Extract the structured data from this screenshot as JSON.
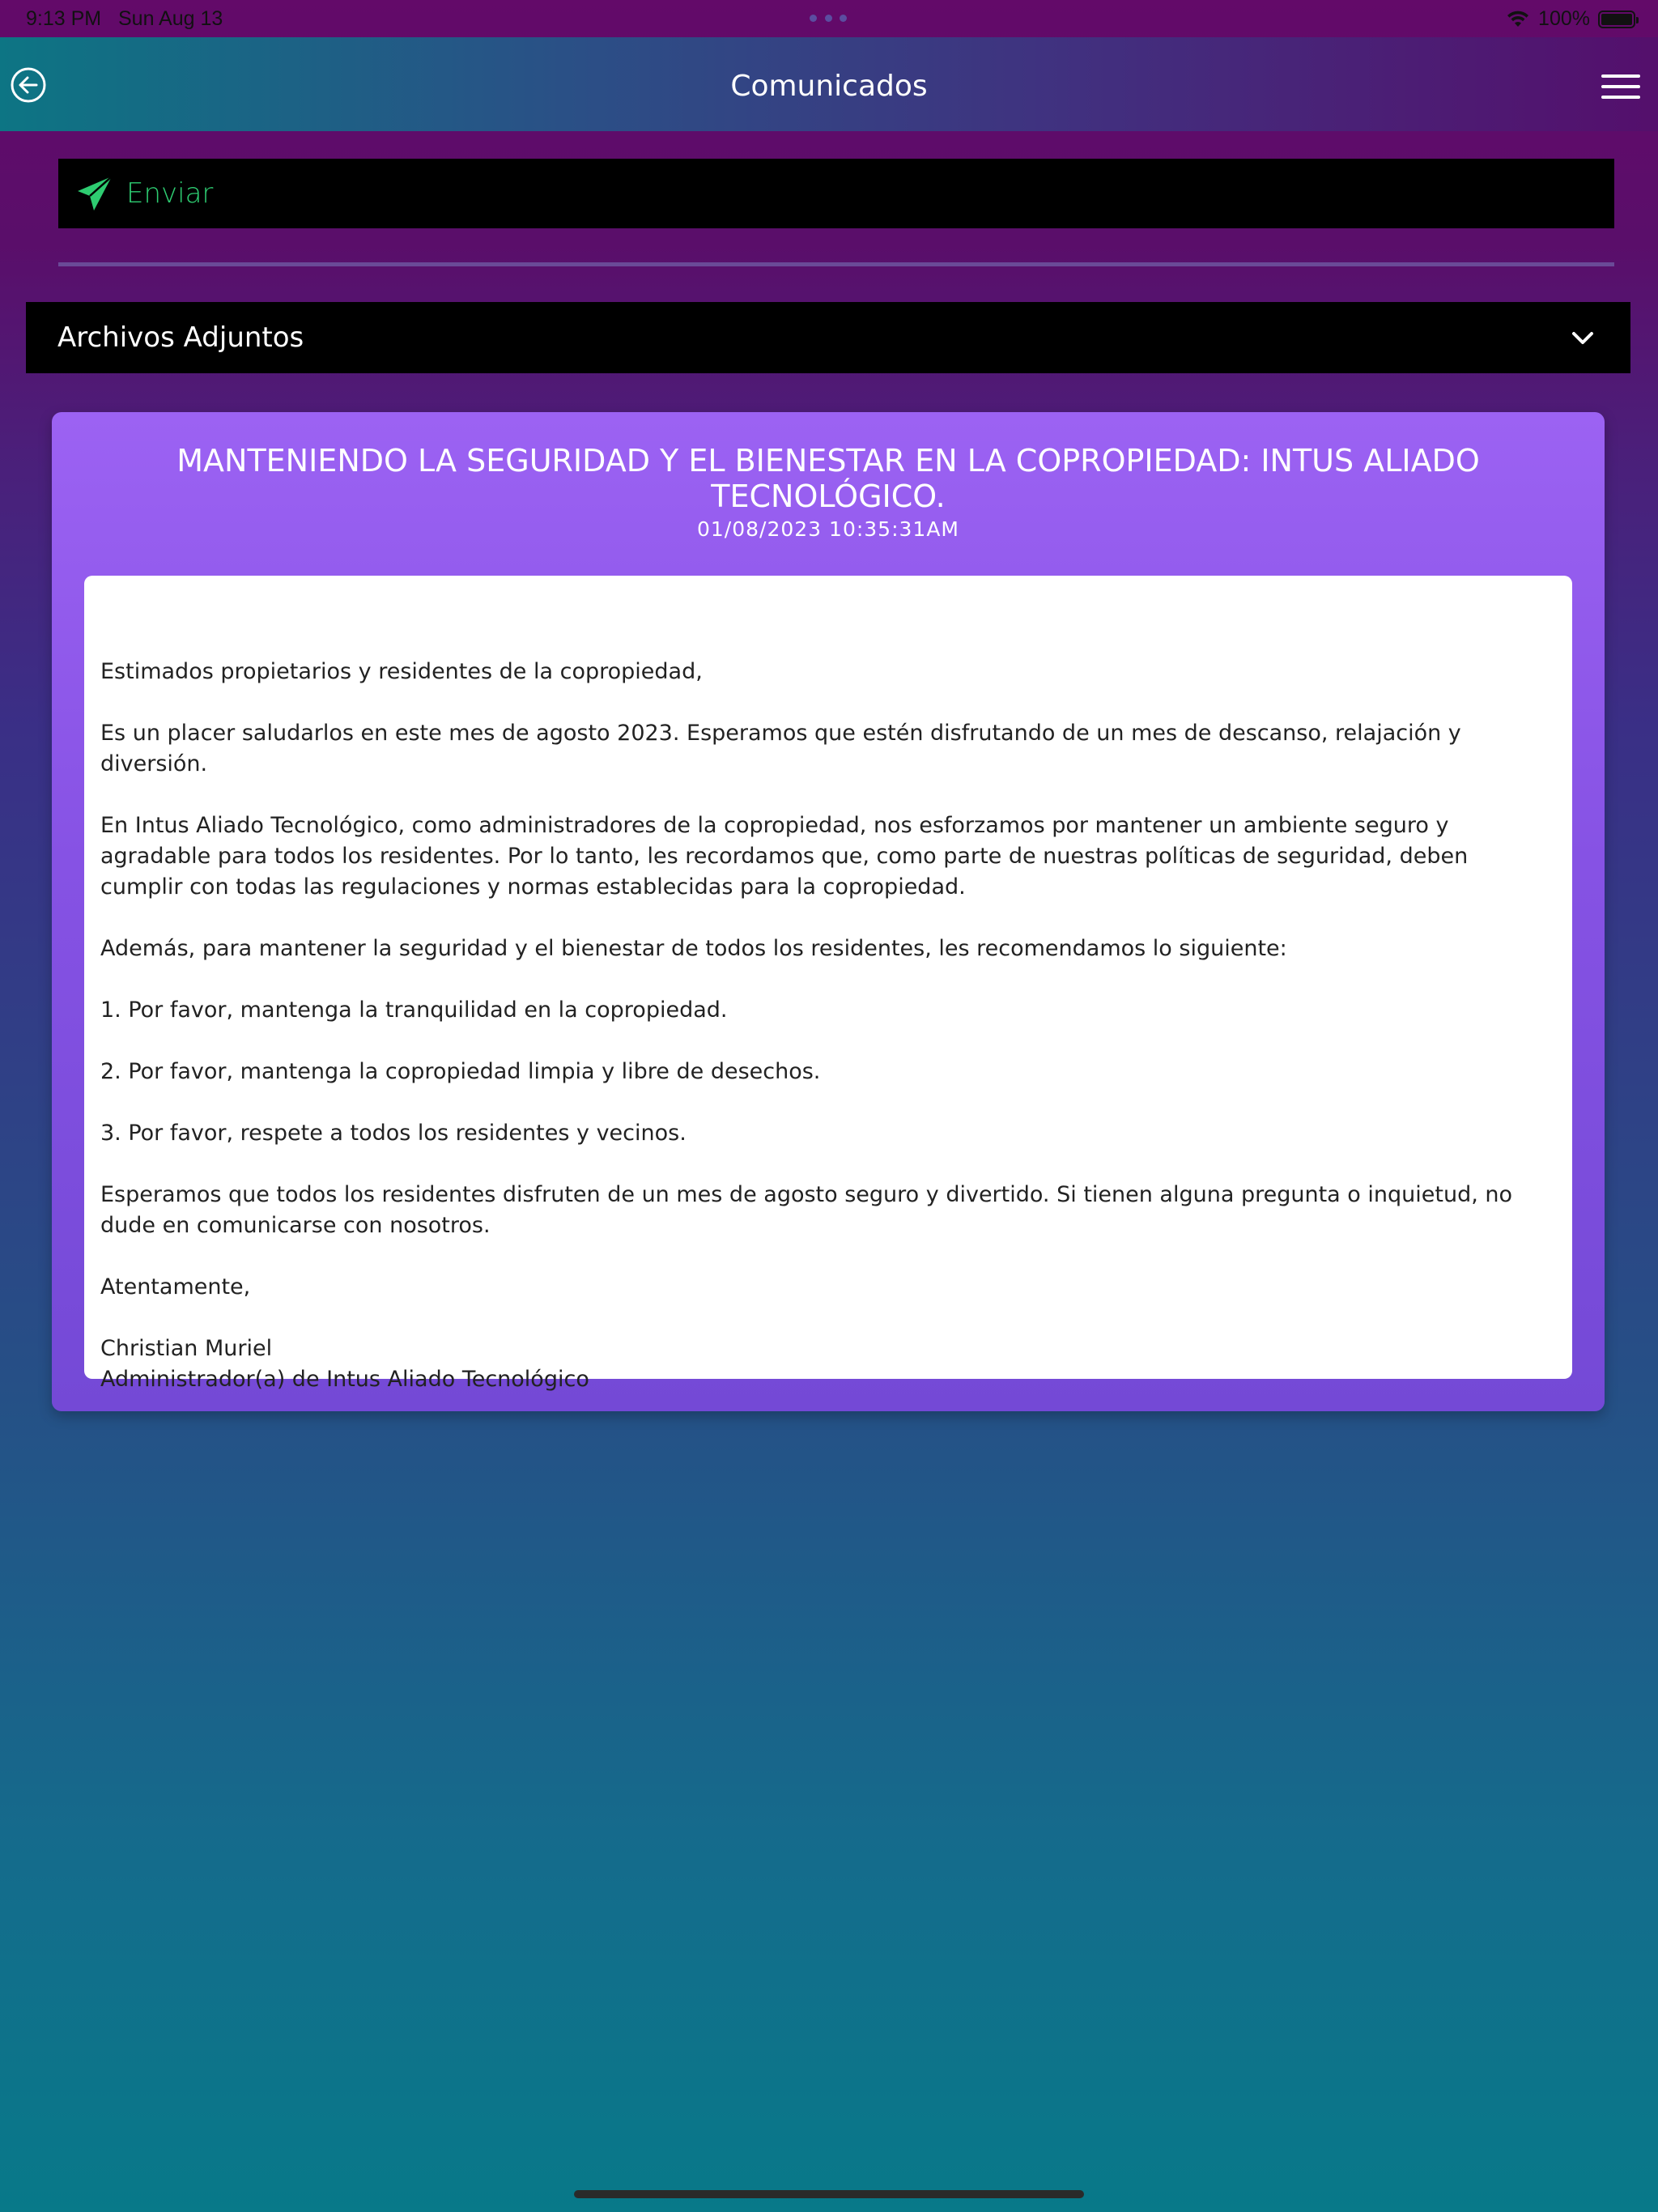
{
  "status_bar": {
    "time": "9:13 PM",
    "date": "Sun Aug 13",
    "battery": "100%"
  },
  "header": {
    "title": "Comunicados"
  },
  "actions": {
    "send_label": "Enviar"
  },
  "attachments": {
    "label": "Archivos Adjuntos"
  },
  "message": {
    "title": "MANTENIENDO LA SEGURIDAD Y EL BIENESTAR EN LA COPROPIEDAD: INTUS ALIADO TECNOLÓGICO.",
    "date": "01/08/2023 10:35:31AM",
    "paragraphs": [
      "Estimados propietarios y residentes de la copropiedad,",
      "Es un placer saludarlos en este mes de agosto 2023. Esperamos que estén disfrutando de un mes de descanso, relajación y diversión.",
      "En Intus Aliado Tecnológico, como administradores de la copropiedad, nos esforzamos por mantener un ambiente seguro y agradable para todos los residentes. Por lo tanto, les recordamos que, como parte de nuestras políticas de seguridad, deben cumplir con todas las regulaciones y normas establecidas para la copropiedad.",
      "Además, para mantener la seguridad y el bienestar de todos los residentes, les recomendamos lo siguiente:",
      "1. Por favor, mantenga la tranquilidad en la copropiedad.",
      "2. Por favor, mantenga la copropiedad limpia y libre de desechos.",
      "3. Por favor, respete a todos los residentes y vecinos.",
      "Esperamos que todos los residentes disfruten de un mes de agosto seguro y divertido. Si tienen alguna pregunta o inquietud, no dude en comunicarse con nosotros.",
      "Atentamente,"
    ],
    "signature_name": "Christian Muriel",
    "signature_role": "Administrador(a) de Intus Aliado Tecnológico"
  },
  "colors": {
    "send_accent": "#2ecc71",
    "card_purple": "#9c62f3",
    "header_teal": "#0d7584",
    "header_purple": "#540f6c"
  },
  "icons": {
    "back": "arrow-left-circle-icon",
    "menu": "hamburger-menu-icon",
    "send": "paper-plane-icon",
    "expand": "chevron-down-icon",
    "wifi": "wifi-icon",
    "battery": "battery-icon"
  }
}
